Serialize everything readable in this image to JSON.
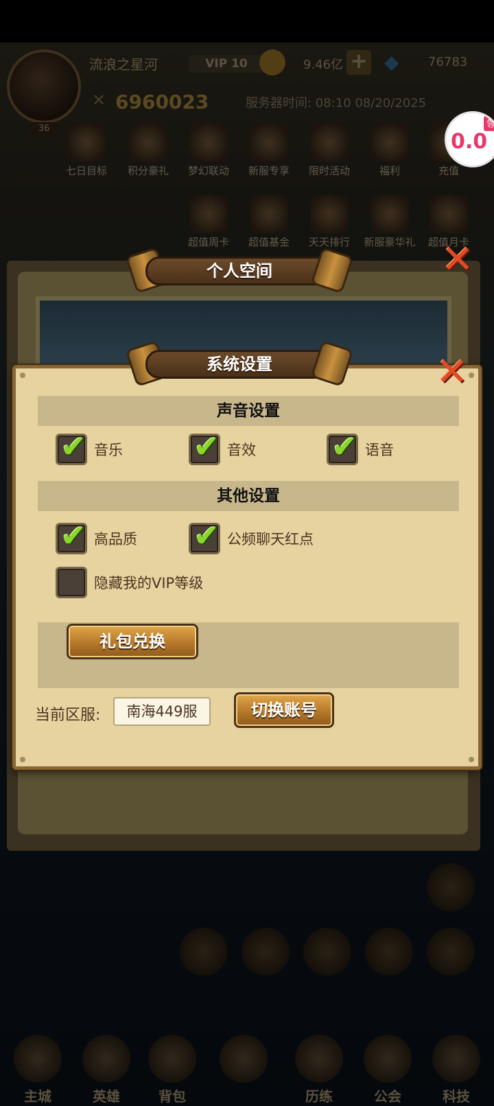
{
  "header": {
    "player_name": "流浪之星河",
    "vip": "VIP 10",
    "coins": "9.46亿",
    "gems": "76783",
    "power": "6960023",
    "server_time": "服务器时间: 08:10 08/20/2025",
    "level": "36"
  },
  "activities_row1": [
    "七日目标",
    "积分豪礼",
    "梦幻联动",
    "新服专享",
    "限时活动",
    "福利",
    "充值"
  ],
  "activities_row2": [
    "超值周卡",
    "超值基金",
    "天天排行",
    "新服豪华礼",
    "超值月卡"
  ],
  "float_badge": {
    "tag": "领",
    "amount": "0.0"
  },
  "personal_panel": {
    "title": "个人空间"
  },
  "bottom_nav": [
    "主城",
    "英雄",
    "背包",
    "",
    "历练",
    "公会",
    "科技"
  ],
  "dialog": {
    "title": "系统设置",
    "sound_section": "声音设置",
    "sound_options": [
      {
        "label": "音乐",
        "checked": true
      },
      {
        "label": "音效",
        "checked": true
      },
      {
        "label": "语音",
        "checked": true
      }
    ],
    "other_section": "其他设置",
    "other_options": [
      {
        "label": "高品质",
        "checked": true
      },
      {
        "label": "公频聊天红点",
        "checked": true
      },
      {
        "label": "隐藏我的VIP等级",
        "checked": false
      }
    ],
    "gift_button": "礼包兑换",
    "server_label": "当前区服:",
    "server_value": "南海449服",
    "switch_button": "切换账号"
  },
  "colors": {
    "dialog_bg": "#e6d3a0",
    "section_bg": "#c9b78c",
    "check_green": "#8ad62a",
    "close_red": "#e24a24"
  }
}
